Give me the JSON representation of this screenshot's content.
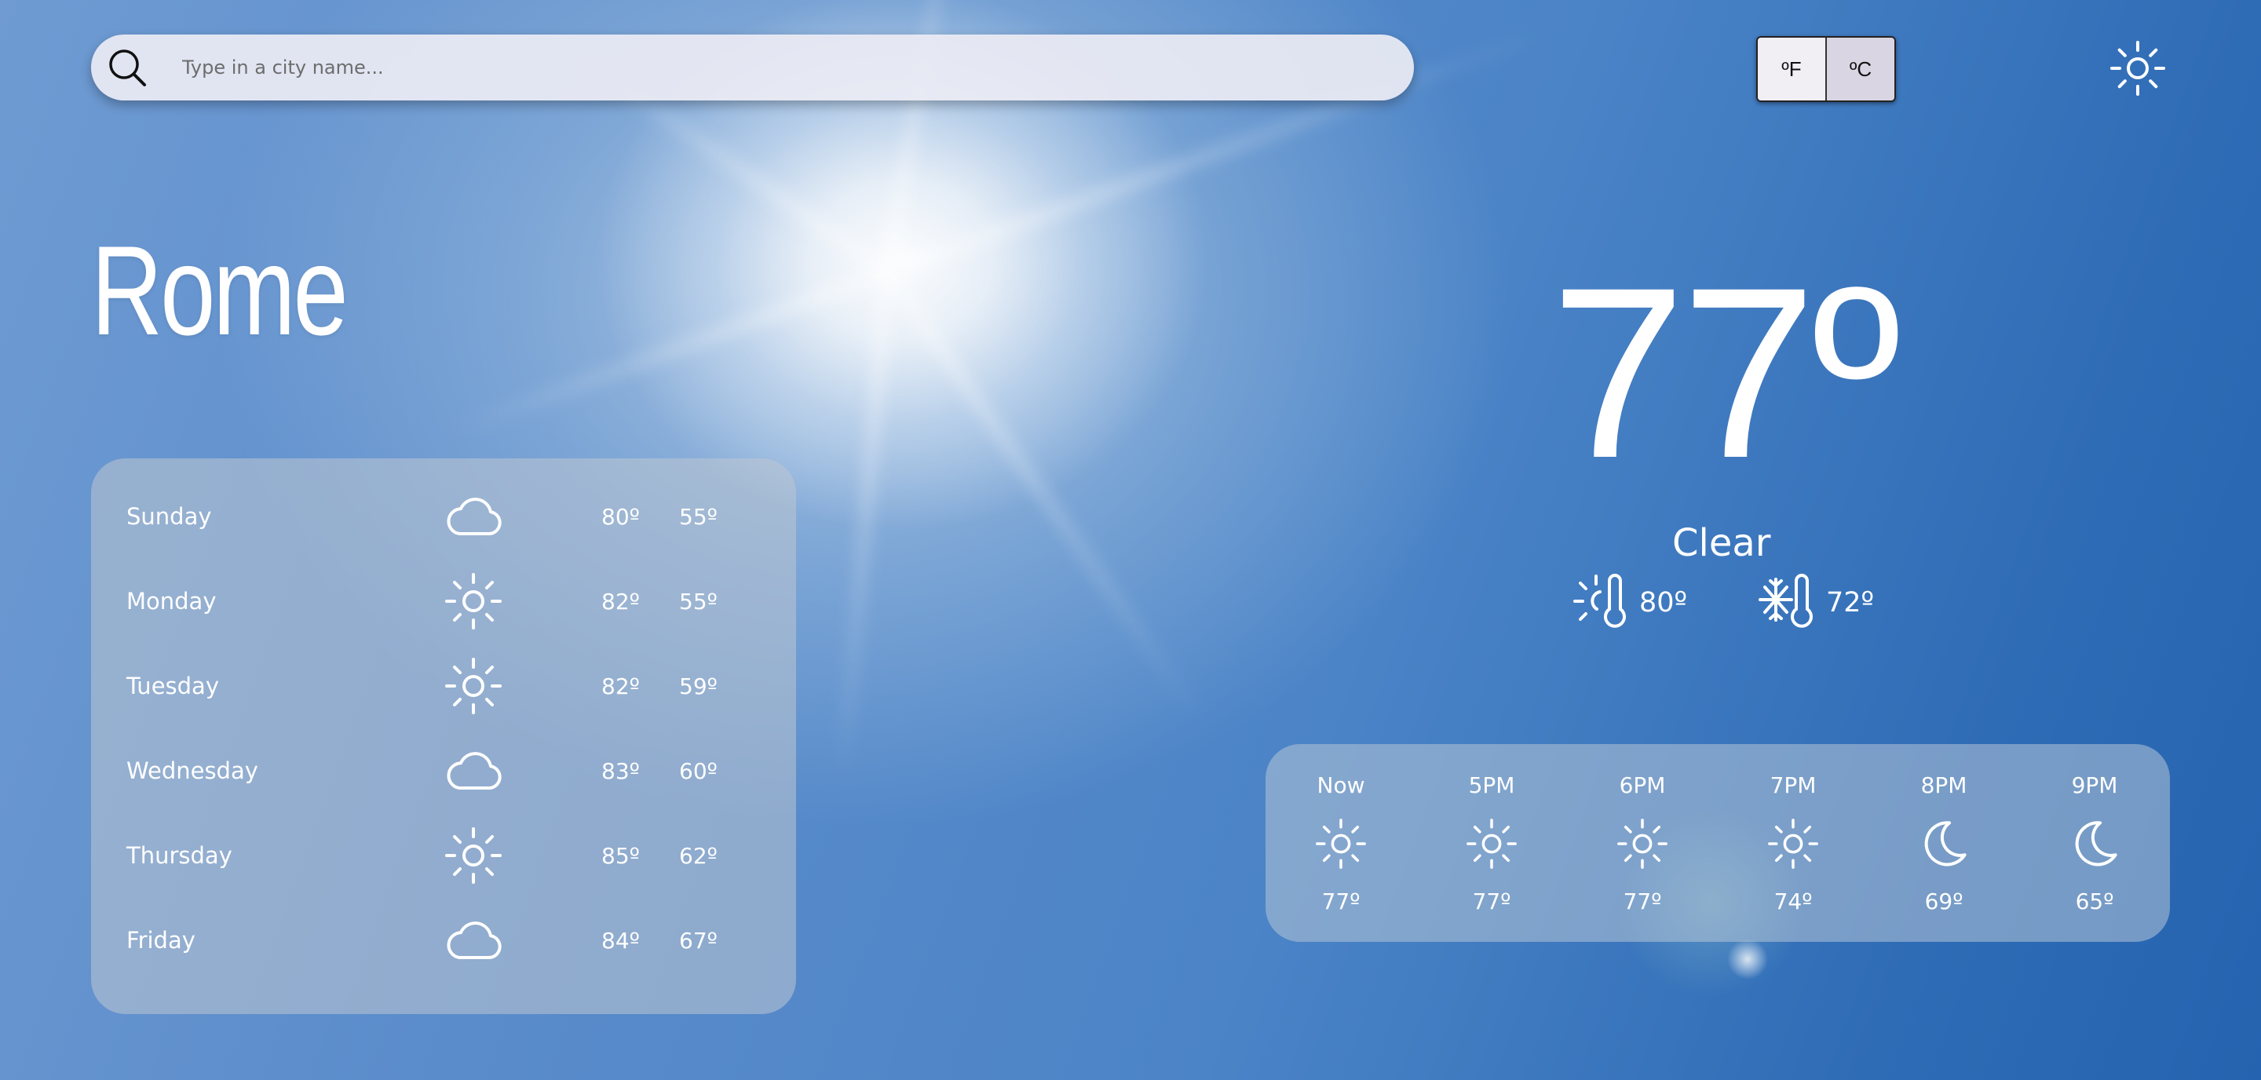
{
  "search": {
    "placeholder": "Type in a city name...",
    "icon": "search-icon"
  },
  "units": {
    "fahrenheit_label": "ºF",
    "celsius_label": "ºC"
  },
  "theme_toggle": {
    "icon": "sun-icon"
  },
  "city": "Rome",
  "current": {
    "temperature": "77º",
    "condition": "Clear",
    "high": "80º",
    "low": "72º",
    "high_icon": "thermometer-sun-icon",
    "low_icon": "thermometer-snowflake-icon"
  },
  "daily": [
    {
      "day": "Sunday",
      "icon": "cloud-icon",
      "high": "80º",
      "low": "55º"
    },
    {
      "day": "Monday",
      "icon": "sun-icon",
      "high": "82º",
      "low": "55º"
    },
    {
      "day": "Tuesday",
      "icon": "sun-icon",
      "high": "82º",
      "low": "59º"
    },
    {
      "day": "Wednesday",
      "icon": "cloud-icon",
      "high": "83º",
      "low": "60º"
    },
    {
      "day": "Thursday",
      "icon": "sun-icon",
      "high": "85º",
      "low": "62º"
    },
    {
      "day": "Friday",
      "icon": "cloud-icon",
      "high": "84º",
      "low": "67º"
    }
  ],
  "hourly": [
    {
      "time": "Now",
      "icon": "sun-icon",
      "temp": "77º"
    },
    {
      "time": "5PM",
      "icon": "sun-icon",
      "temp": "77º"
    },
    {
      "time": "6PM",
      "icon": "sun-icon",
      "temp": "77º"
    },
    {
      "time": "7PM",
      "icon": "sun-icon",
      "temp": "74º"
    },
    {
      "time": "8PM",
      "icon": "moon-icon",
      "temp": "69º"
    },
    {
      "time": "9PM",
      "icon": "moon-icon",
      "temp": "65º"
    }
  ]
}
